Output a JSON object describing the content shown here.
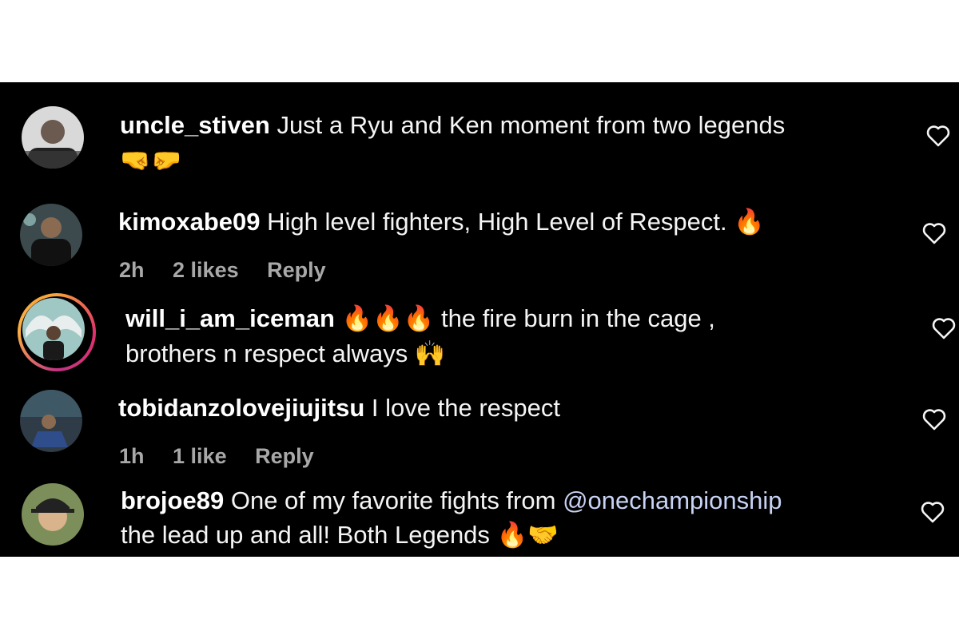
{
  "colors": {
    "panel": "#000000",
    "text": "#f5f5f5",
    "meta": "#a8a8a8",
    "mention": "#c8d3f5",
    "story_ring": "#e1306c"
  },
  "comments": [
    {
      "username": "uncle_stiven",
      "text": "Just a Ryu and Ken moment from two legends",
      "emoji_line2": "🤜🤛"
    },
    {
      "username": "kimoxabe09",
      "text": "High level fighters, High Level of Respect.",
      "emoji": "🔥",
      "time": "2h",
      "likes": "2 likes",
      "reply": "Reply"
    },
    {
      "username": "will_i_am_iceman",
      "emoji": "🔥🔥🔥",
      "text": "the fire burn in the cage ,",
      "text_line2": "brothers n respect always",
      "emoji_line2": "🙌"
    },
    {
      "username": "tobidanzolovejiujitsu",
      "text": "I love the respect",
      "time": "1h",
      "likes": "1 like",
      "reply": "Reply"
    },
    {
      "username": "brojoe89",
      "text": "One of my favorite fights from",
      "mention": "@onechampionship",
      "text_line2": "the lead up and all! Both Legends",
      "emoji_line2": "🔥🤝"
    }
  ]
}
